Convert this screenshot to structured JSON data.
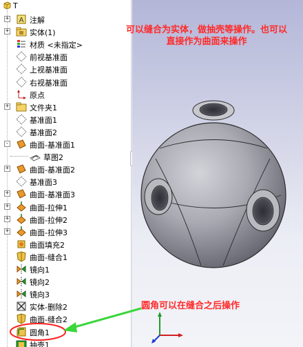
{
  "tree": {
    "root_label": "T",
    "items": [
      {
        "label": "注解",
        "icon": "annotation-icon",
        "expander": "+"
      },
      {
        "label": "实体(1)",
        "icon": "solid-bodies-folder-icon",
        "expander": "+"
      },
      {
        "label": "材质 <未指定>",
        "icon": "material-icon",
        "expander": ""
      },
      {
        "label": "前视基准面",
        "icon": "plane-icon",
        "expander": ""
      },
      {
        "label": "上视基准面",
        "icon": "plane-icon",
        "expander": ""
      },
      {
        "label": "右视基准面",
        "icon": "plane-icon",
        "expander": ""
      },
      {
        "label": "原点",
        "icon": "origin-icon",
        "expander": ""
      },
      {
        "label": "文件夹1",
        "icon": "folder-icon",
        "expander": "+"
      },
      {
        "label": "基准面1",
        "icon": "plane-icon",
        "expander": ""
      },
      {
        "label": "基准面2",
        "icon": "plane-icon",
        "expander": ""
      },
      {
        "label": "曲面-基准面1",
        "icon": "planar-surface-icon",
        "expander": "-"
      },
      {
        "label": "草图2",
        "icon": "sketch-icon",
        "expander": "",
        "child": true
      },
      {
        "label": "曲面-基准面2",
        "icon": "planar-surface-icon",
        "expander": "+"
      },
      {
        "label": "基准面3",
        "icon": "plane-icon",
        "expander": ""
      },
      {
        "label": "曲面-基准面3",
        "icon": "planar-surface-icon",
        "expander": "+"
      },
      {
        "label": "曲面-拉伸1",
        "icon": "surface-extrude-icon",
        "expander": "+"
      },
      {
        "label": "曲面-拉伸2",
        "icon": "surface-extrude-icon",
        "expander": "+"
      },
      {
        "label": "曲面-拉伸3",
        "icon": "surface-extrude-icon",
        "expander": "+"
      },
      {
        "label": "曲面填充2",
        "icon": "surface-fill-icon",
        "expander": ""
      },
      {
        "label": "曲面-缝合1",
        "icon": "surface-knit-icon",
        "expander": ""
      },
      {
        "label": "镜向1",
        "icon": "mirror-icon",
        "expander": ""
      },
      {
        "label": "镜向2",
        "icon": "mirror-icon",
        "expander": ""
      },
      {
        "label": "镜向3",
        "icon": "mirror-icon",
        "expander": ""
      },
      {
        "label": "实体-删除2",
        "icon": "delete-body-icon",
        "expander": ""
      },
      {
        "label": "曲面-缝合2",
        "icon": "surface-knit-icon",
        "expander": ""
      },
      {
        "label": "圆角1",
        "icon": "fillet-icon",
        "expander": ""
      },
      {
        "label": "抽壳1",
        "icon": "shell-icon",
        "expander": ""
      }
    ]
  },
  "annotations": {
    "top_note": "可以缝合为实体，做抽壳等操作。也可以直接作为曲面来操作",
    "bottom_note": "圆角可以在缝合之后操作"
  },
  "colors": {
    "note": "#ff2a2a",
    "arrow": "#3ad63a",
    "highlight_circle": "#ff1f1f",
    "viewport_top": "#b3b6d8",
    "viewport_bottom": "#f3f4f8"
  }
}
